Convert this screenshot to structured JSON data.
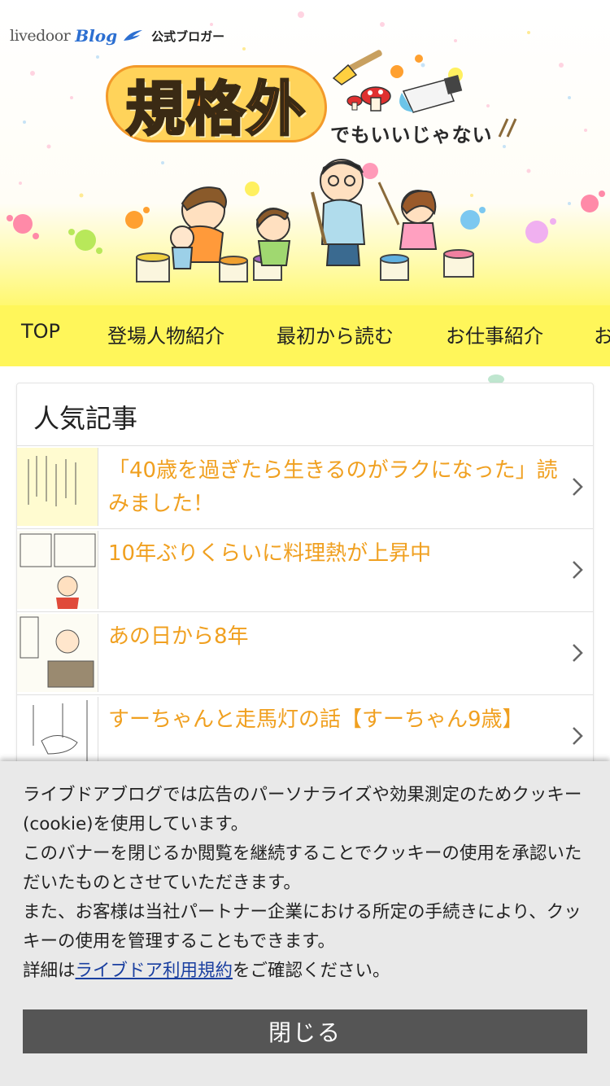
{
  "header": {
    "brand_livedoor": "livedoor",
    "brand_blog": "Blog",
    "brand_official": "公式ブロガー",
    "logo_title": "規格外",
    "logo_subtitle": "でもいいじゃない"
  },
  "nav": {
    "items": [
      {
        "label": "TOP"
      },
      {
        "label": "登場人物紹介"
      },
      {
        "label": "最初から読む"
      },
      {
        "label": "お仕事紹介"
      },
      {
        "label": "お"
      }
    ]
  },
  "popular": {
    "title": "人気記事",
    "articles": [
      {
        "title": "「40歳を過ぎたら生きるのがラクになった」読みました！"
      },
      {
        "title": "10年ぶりくらいに料理熱が上昇中"
      },
      {
        "title": "あの日から8年"
      },
      {
        "title": "すーちゃんと走馬灯の話【すーちゃん9歳】"
      }
    ]
  },
  "cookie": {
    "line1": "ライブドアブログでは広告のパーソナライズや効果測定のためクッキー(cookie)を使用しています。",
    "line2": "このバナーを閉じるか閲覧を継続することでクッキーの使用を承認いただいたものとさせていただきます。",
    "line3": "また、お客様は当社パートナー企業における所定の手続きにより、クッキーの使用を管理することもできます。",
    "detail_prefix": "詳細は",
    "detail_link": "ライブドア利用規約",
    "detail_suffix": "をご確認ください。",
    "close_label": "閉じる"
  },
  "colors": {
    "nav_bg": "#fff65a",
    "article_title": "#f0a020",
    "close_button_bg": "#555555",
    "cookie_bg": "#e9e9e9",
    "link": "#1a3fa0"
  },
  "icons": {
    "chevron": "chevron-right-icon",
    "blog_wing": "wing-icon"
  }
}
